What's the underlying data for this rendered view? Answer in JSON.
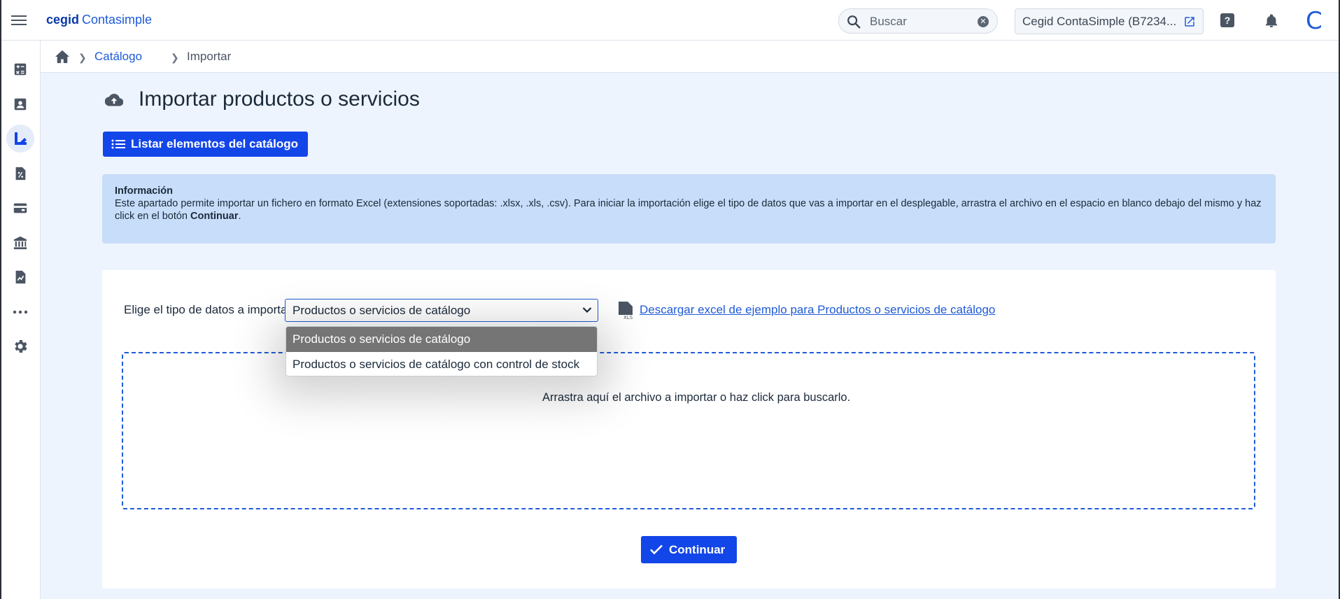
{
  "header": {
    "brand_bold": "cegid",
    "brand_rest": "Contasimple",
    "search_placeholder": "Buscar",
    "company": "Cegid ContaSimple (B7234...",
    "avatar_letter": "C"
  },
  "breadcrumb": {
    "link": "Catálogo",
    "current": "Importar"
  },
  "page": {
    "title": "Importar productos o servicios",
    "list_button": "Listar elementos del catálogo"
  },
  "info": {
    "title": "Información",
    "text_1": "Este apartado permite importar un fichero en formato Excel (extensiones soportadas: .xlsx, .xls, .csv). Para iniciar la importación elige el tipo de datos que vas a importar en el desplegable, arrastra el archivo en el espacio en blanco debajo del mismo y haz click en el botón ",
    "text_bold": "Continuar",
    "text_end": "."
  },
  "form": {
    "type_label": "Elige el tipo de datos a importar:",
    "selected": "Productos o servicios de catálogo",
    "options": [
      "Productos o servicios de catálogo",
      "Productos o servicios de catálogo con control de stock"
    ],
    "download_link": "Descargar excel de ejemplo para Productos o servicios de catálogo",
    "xls_label": "XLS",
    "drop_text": "Arrastra aquí el archivo a importar o haz click para buscarlo.",
    "continue_label": "Continuar"
  },
  "colors": {
    "primary": "#1346e8",
    "link": "#1f5bd8",
    "info_bg": "#c7ddf9",
    "page_bg": "#eef4fd"
  },
  "sidebar_icons": [
    "calculator-icon",
    "contacts-icon",
    "catalog-icon",
    "invoice-percent-icon",
    "wallet-icon",
    "bank-icon",
    "chart-report-icon",
    "more-icon",
    "settings-icon"
  ]
}
